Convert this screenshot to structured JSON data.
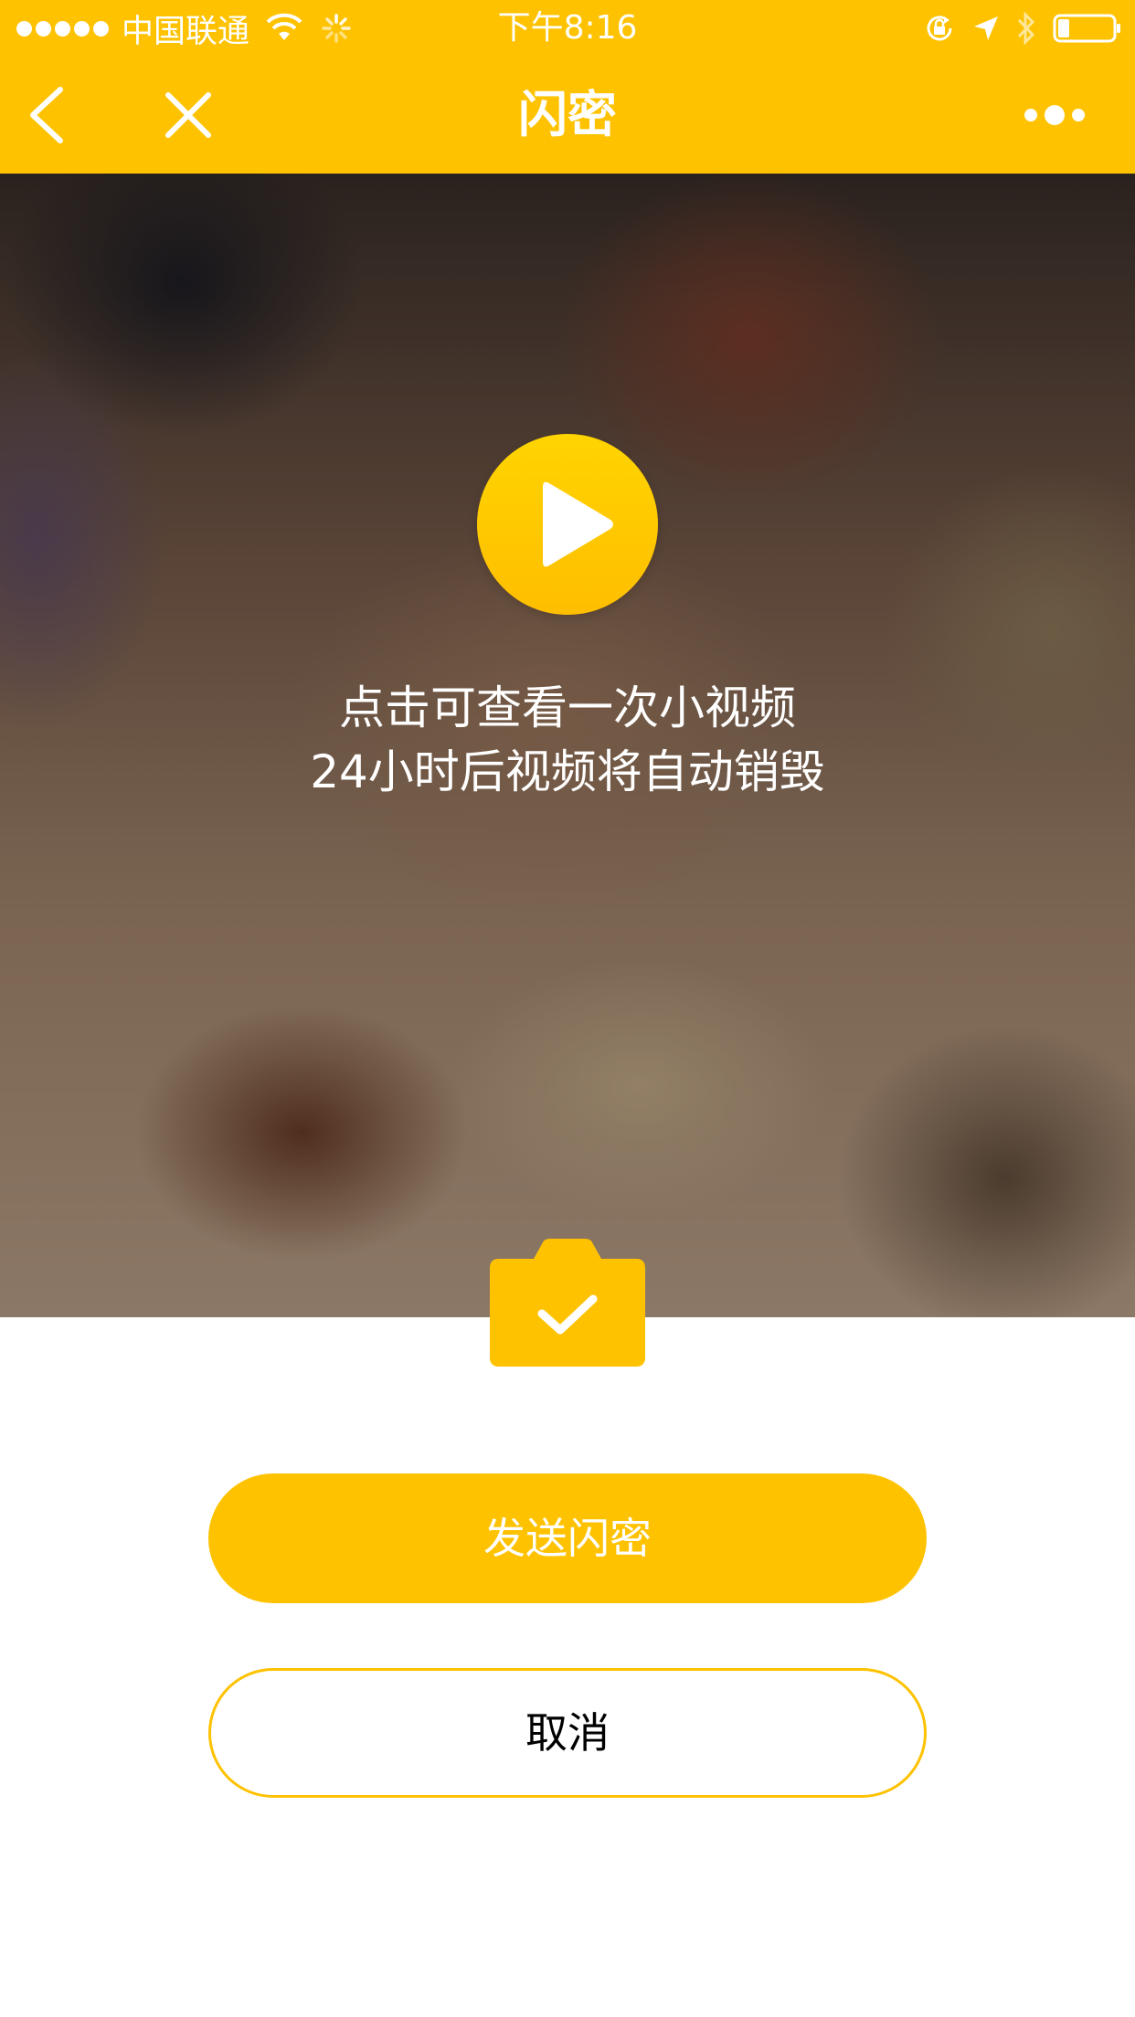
{
  "status_bar": {
    "carrier": "中国联通",
    "time": "下午8:16",
    "icons": [
      "signal-dots-icon",
      "wifi-icon",
      "activity-spinner-icon",
      "orientation-lock-icon",
      "location-arrow-icon",
      "bluetooth-icon",
      "battery-icon"
    ],
    "battery_level": 0.2
  },
  "nav": {
    "title": "闪密",
    "back_icon": "chevron-left-icon",
    "close_icon": "close-icon",
    "more_icon": "more-dots-icon"
  },
  "media": {
    "play_icon": "play-icon",
    "caption_line1": "点击可查看一次小视频",
    "caption_line2": "24小时后视频将自动销毁"
  },
  "camera_icon": "camera-check-icon",
  "actions": {
    "send_label": "发送闪密",
    "cancel_label": "取消"
  },
  "colors": {
    "accent": "#fec200",
    "text_on_accent": "#ffffff",
    "cancel_text": "#000000"
  }
}
